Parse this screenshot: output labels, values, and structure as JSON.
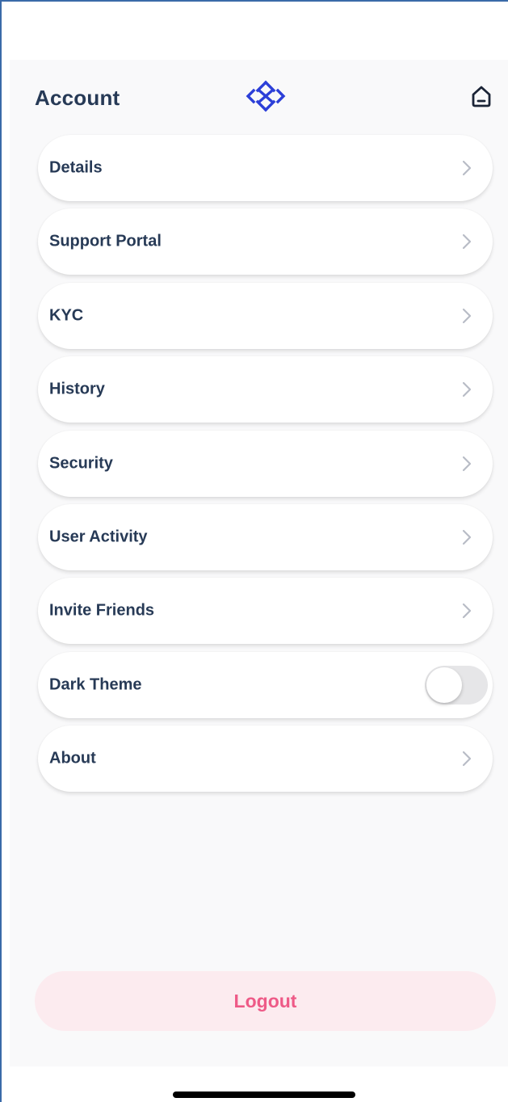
{
  "header": {
    "title": "Account",
    "logo_icon": "brand-logo-icon",
    "home_icon": "home-icon"
  },
  "menu": {
    "items": [
      {
        "label": "Details",
        "control": "chevron"
      },
      {
        "label": "Support Portal",
        "control": "chevron"
      },
      {
        "label": "KYC",
        "control": "chevron"
      },
      {
        "label": "History",
        "control": "chevron"
      },
      {
        "label": "Security",
        "control": "chevron"
      },
      {
        "label": "User Activity",
        "control": "chevron"
      },
      {
        "label": "Invite Friends",
        "control": "chevron"
      },
      {
        "label": "Dark Theme",
        "control": "toggle",
        "toggle_on": false
      },
      {
        "label": "About",
        "control": "chevron"
      }
    ]
  },
  "logout": {
    "label": "Logout"
  },
  "colors": {
    "text_primary": "#273a56",
    "brand_blue": "#2c3fd8",
    "logout_text": "#ee5a87",
    "logout_bg": "#fcebef",
    "chevron": "#b8bcc6",
    "toggle_off": "#e6e6e8"
  }
}
